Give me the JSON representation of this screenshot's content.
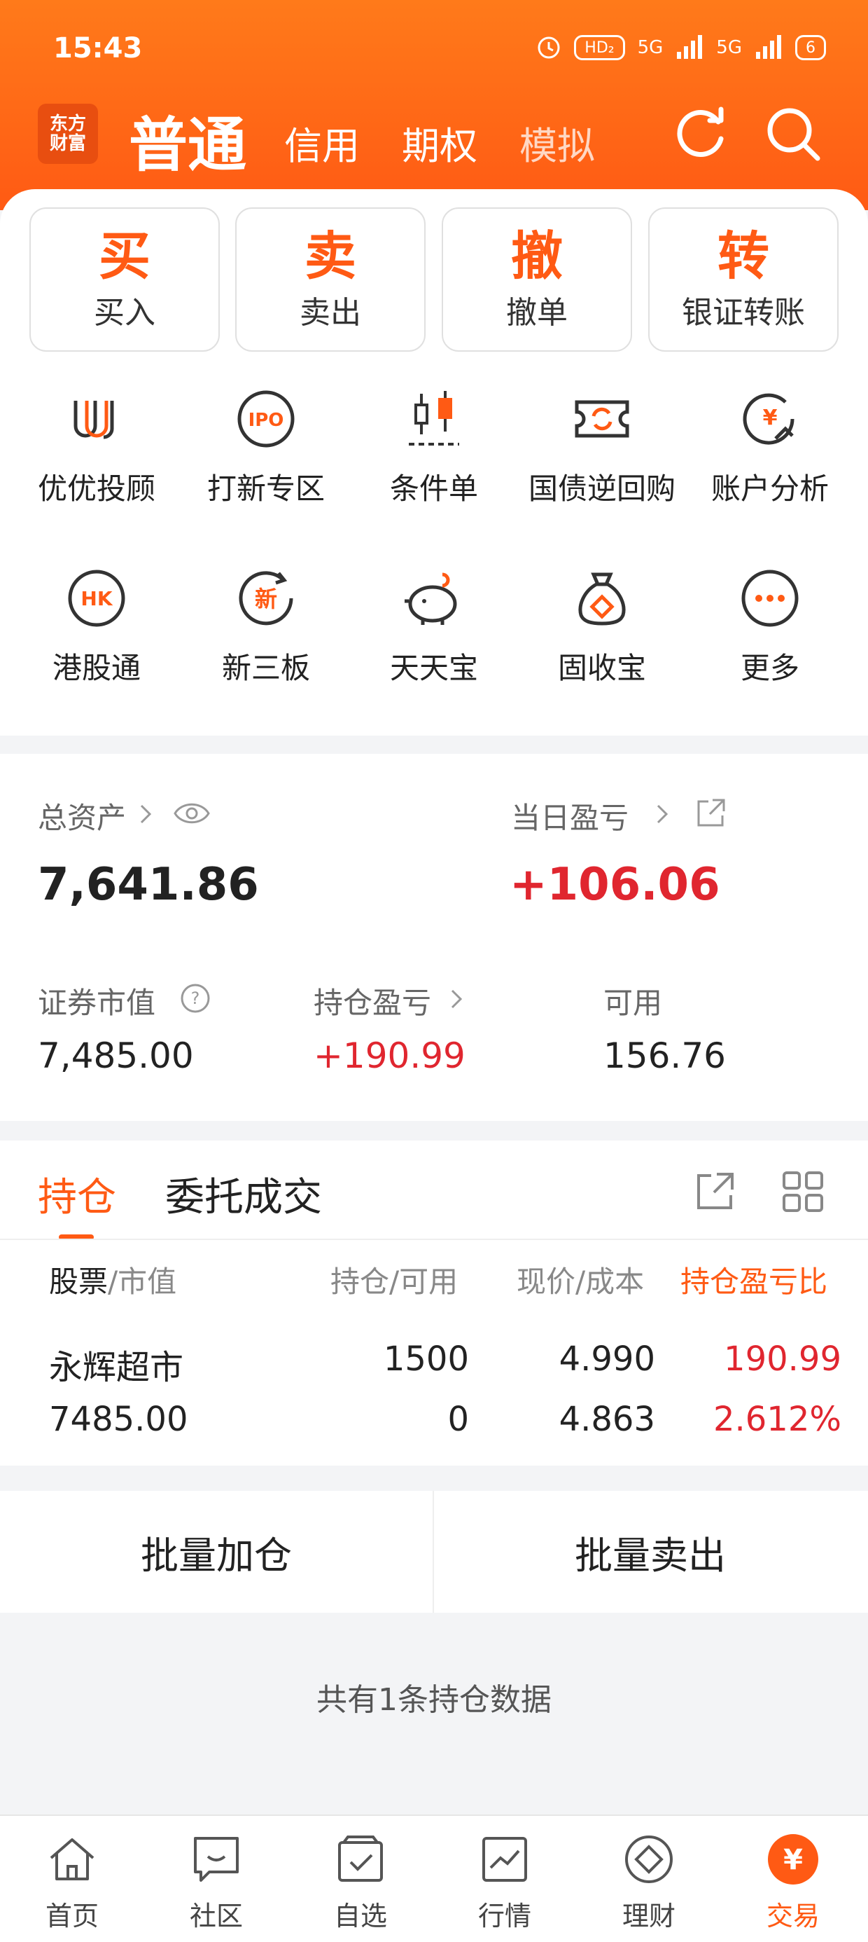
{
  "status": {
    "time": "15:43",
    "hd": "HD₂",
    "net1": "5G",
    "net2": "5G",
    "battery": "6"
  },
  "header": {
    "logo_line1": "东方",
    "logo_line2": "财富",
    "active_tab": "普通",
    "tabs": [
      "信用",
      "期权",
      "模拟"
    ]
  },
  "trade_buttons": [
    {
      "big": "买",
      "label": "买入"
    },
    {
      "big": "卖",
      "label": "卖出"
    },
    {
      "big": "撤",
      "label": "撤单"
    },
    {
      "big": "转",
      "label": "银证转账"
    }
  ],
  "features": [
    {
      "label": "优优投顾",
      "icon": "uu-advisor-icon"
    },
    {
      "label": "打新专区",
      "icon": "ipo-icon"
    },
    {
      "label": "条件单",
      "icon": "candlestick-icon"
    },
    {
      "label": "国债逆回购",
      "icon": "repo-ticket-icon"
    },
    {
      "label": "账户分析",
      "icon": "yen-analysis-icon"
    },
    {
      "label": "港股通",
      "icon": "hk-icon"
    },
    {
      "label": "新三板",
      "icon": "new-board-icon"
    },
    {
      "label": "天天宝",
      "icon": "piggy-bank-icon"
    },
    {
      "label": "固收宝",
      "icon": "money-bag-icon"
    },
    {
      "label": "更多",
      "icon": "more-dots-icon"
    }
  ],
  "assets": {
    "total_label": "总资产",
    "total_value": "7,641.86",
    "daily_label": "当日盈亏",
    "daily_value": "+106.06",
    "market_label": "证券市值",
    "market_value": "7,485.00",
    "position_pl_label": "持仓盈亏",
    "position_pl_value": "+190.99",
    "available_label": "可用",
    "available_value": "156.76"
  },
  "holdings": {
    "tab_active": "持仓",
    "tab_other": "委托成交",
    "col_stock": "股票",
    "col_stock2": "/市值",
    "col_position": "持仓/可用",
    "col_price": "现价/成本",
    "col_pl": "持仓盈亏比",
    "rows": [
      {
        "name": "永辉超市",
        "market_value": "7485.00",
        "position": "1500",
        "available": "0",
        "price": "4.990",
        "cost": "4.863",
        "pl": "190.99",
        "pl_ratio": "2.612%"
      }
    ]
  },
  "batch": {
    "add": "批量加仓",
    "sell": "批量卖出"
  },
  "summary": "共有1条持仓数据",
  "bottom_nav": [
    "首页",
    "社区",
    "自选",
    "行情",
    "理财",
    "交易"
  ],
  "colors": {
    "accent": "#ff5a14",
    "red": "#e0262f"
  }
}
